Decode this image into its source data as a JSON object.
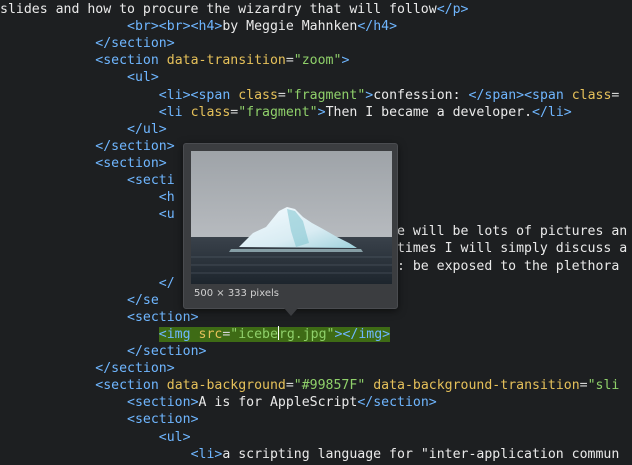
{
  "editor": {
    "lines": [
      {
        "indent": "",
        "parts": [
          {
            "t": "text",
            "v": "slides and how to procure the wizardry that will follow"
          },
          {
            "t": "tag",
            "v": "</p>"
          }
        ]
      },
      {
        "indent": "                ",
        "parts": [
          {
            "t": "tag",
            "v": "<br><br><h4>"
          },
          {
            "t": "text",
            "v": "by Meggie Mahnken"
          },
          {
            "t": "tag",
            "v": "</h4>"
          }
        ]
      },
      {
        "indent": "            ",
        "parts": [
          {
            "t": "tag",
            "v": "</section>"
          }
        ]
      },
      {
        "indent": "            ",
        "parts": [
          {
            "t": "tag",
            "v": "<section "
          },
          {
            "t": "attr",
            "v": "data-transition"
          },
          {
            "t": "punct",
            "v": "="
          },
          {
            "t": "str",
            "v": "\"zoom\""
          },
          {
            "t": "tag",
            "v": ">"
          }
        ]
      },
      {
        "indent": "                ",
        "parts": [
          {
            "t": "tag",
            "v": "<ul>"
          }
        ]
      },
      {
        "indent": "                    ",
        "parts": [
          {
            "t": "tag",
            "v": "<li><span "
          },
          {
            "t": "attr",
            "v": "class"
          },
          {
            "t": "punct",
            "v": "="
          },
          {
            "t": "str",
            "v": "\"fragment\""
          },
          {
            "t": "tag",
            "v": ">"
          },
          {
            "t": "text",
            "v": "confession: "
          },
          {
            "t": "tag",
            "v": "</span><span "
          },
          {
            "t": "attr",
            "v": "class"
          },
          {
            "t": "punct",
            "v": "="
          }
        ]
      },
      {
        "indent": "                    ",
        "parts": [
          {
            "t": "tag",
            "v": "<li "
          },
          {
            "t": "attr",
            "v": "class"
          },
          {
            "t": "punct",
            "v": "="
          },
          {
            "t": "str",
            "v": "\"fragment\""
          },
          {
            "t": "tag",
            "v": ">"
          },
          {
            "t": "text",
            "v": "Then I became a developer."
          },
          {
            "t": "tag",
            "v": "</li>"
          }
        ]
      },
      {
        "indent": "                ",
        "parts": [
          {
            "t": "tag",
            "v": "</ul>"
          }
        ]
      },
      {
        "indent": "            ",
        "parts": [
          {
            "t": "tag",
            "v": "</section>"
          }
        ]
      },
      {
        "indent": "            ",
        "parts": [
          {
            "t": "tag",
            "v": "<section>"
          }
        ]
      },
      {
        "indent": "                ",
        "parts": [
          {
            "t": "tag",
            "v": "<secti"
          }
        ]
      },
      {
        "indent": "                    ",
        "parts": [
          {
            "t": "tag",
            "v": "<h"
          }
        ]
      },
      {
        "indent": "                    ",
        "parts": [
          {
            "t": "tag",
            "v": "<u"
          }
        ]
      },
      {
        "indent": "                                                  ",
        "parts": [
          {
            "t": "text",
            "v": "e will be lots of pictures an"
          }
        ]
      },
      {
        "indent": "                                                  ",
        "parts": [
          {
            "t": "text",
            "v": "times I will simply discuss a"
          }
        ]
      },
      {
        "indent": "                                                  ",
        "parts": [
          {
            "t": "text",
            "v": ": be exposed to the plethora "
          }
        ]
      },
      {
        "indent": "                    ",
        "parts": [
          {
            "t": "tag",
            "v": "</"
          }
        ]
      },
      {
        "indent": "                ",
        "parts": [
          {
            "t": "tag",
            "v": "</se"
          }
        ]
      },
      {
        "indent": "                ",
        "parts": [
          {
            "t": "tag",
            "v": "<section>"
          }
        ]
      },
      {
        "indent": "                    ",
        "highlight": true,
        "parts": [
          {
            "t": "tag",
            "v": "<img "
          },
          {
            "t": "attr",
            "v": "src"
          },
          {
            "t": "punct",
            "v": "="
          },
          {
            "t": "str",
            "v": "\"icebe"
          },
          {
            "t": "caret",
            "v": ""
          },
          {
            "t": "str",
            "v": "rg.jpg\""
          },
          {
            "t": "tag",
            "v": "></img>"
          }
        ]
      },
      {
        "indent": "                ",
        "parts": [
          {
            "t": "tag",
            "v": "</section>"
          }
        ]
      },
      {
        "indent": "            ",
        "parts": [
          {
            "t": "tag",
            "v": "</section>"
          }
        ]
      },
      {
        "indent": "            ",
        "parts": [
          {
            "t": "tag",
            "v": "<section "
          },
          {
            "t": "attr",
            "v": "data-background"
          },
          {
            "t": "punct",
            "v": "="
          },
          {
            "t": "str",
            "v": "\"#99857F\""
          },
          {
            "t": "text",
            "v": " "
          },
          {
            "t": "attr",
            "v": "data-background-transition"
          },
          {
            "t": "punct",
            "v": "="
          },
          {
            "t": "str",
            "v": "\"sli"
          }
        ]
      },
      {
        "indent": "                ",
        "parts": [
          {
            "t": "tag",
            "v": "<section>"
          },
          {
            "t": "text",
            "v": "A is for AppleScript"
          },
          {
            "t": "tag",
            "v": "</section>"
          }
        ]
      },
      {
        "indent": "                ",
        "parts": [
          {
            "t": "tag",
            "v": "<section>"
          }
        ]
      },
      {
        "indent": "                    ",
        "parts": [
          {
            "t": "tag",
            "v": "<ul>"
          }
        ]
      },
      {
        "indent": "                        ",
        "parts": [
          {
            "t": "tag",
            "v": "<li>"
          },
          {
            "t": "text",
            "v": "a scripting language for \"inter-application commun"
          }
        ]
      }
    ]
  },
  "popover": {
    "caption": "500 × 333 pixels",
    "image_icon": "iceberg-image"
  },
  "colors": {
    "background": "#1d1f21",
    "tag": "#6fb6ff",
    "attribute": "#e6c15a",
    "string": "#8fd06a",
    "highlight": "#3e6b15"
  }
}
